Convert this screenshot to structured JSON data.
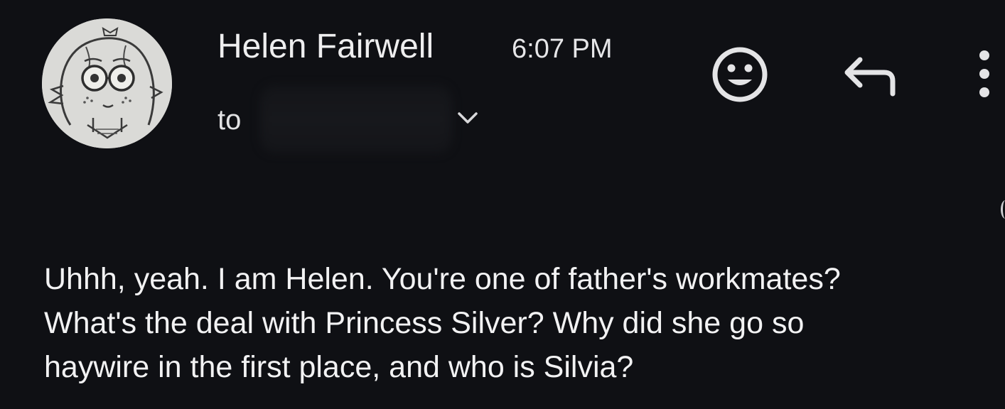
{
  "header": {
    "sender_name": "Helen Fairwell",
    "sent_time": "6:07 PM",
    "to_label": "to",
    "avatar_icon": "hand-drawn-portrait-avatar"
  },
  "actions": {
    "emoji_icon": "smiley-face-icon",
    "reply_icon": "reply-arrow-icon",
    "more_icon": "vertical-ellipsis-icon",
    "expand_icon": "chevron-down-icon"
  },
  "body": {
    "lines": [
      "Uhhh, yeah. I am Helen. You're one of father's workmates?",
      "What's the deal with Princess Silver? Why did she go so",
      "haywire in the first place, and who is Silvia?"
    ]
  },
  "colors": {
    "background": "#0f1014",
    "text": "#f2f2f3",
    "icon": "#e4e4e6"
  }
}
